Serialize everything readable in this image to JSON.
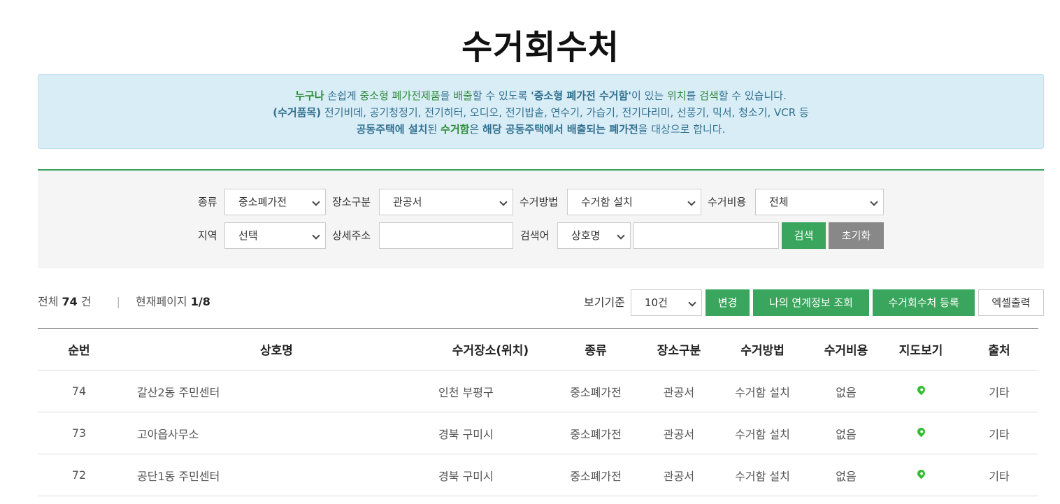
{
  "page": {
    "title": "수거회수처"
  },
  "notice": {
    "line1": {
      "a": "누구나",
      "b": " 손쉽게 ",
      "c": "중소형 폐가전제품",
      "d": "을 ",
      "e": "배출",
      "f": "할 수 있도록 ",
      "g": "'중소형 폐가전 수거함'",
      "h": "이 있는 ",
      "i": "위치",
      "j": "를 ",
      "k": "검색",
      "l": "할 수 있습니다."
    },
    "line2": {
      "a": "(수거품목)",
      "b": " 전기비데, 공기청정기, 전기히터, 오디오, 전기밥솥, 연수기, 가습기, 전기다리미, 선풍기, 믹서, 청소기, VCR 등"
    },
    "line3": {
      "a": "공동주택에 설치",
      "b": "된 ",
      "c": "수거함",
      "d": "은 ",
      "e": "해당 공동주택에서 배출되는 폐가전",
      "f": "을 대상으로 합니다."
    }
  },
  "search": {
    "type_label": "종류",
    "type_value": "중소폐가전",
    "place_label": "장소구분",
    "place_value": "관공서",
    "method_label": "수거방법",
    "method_value": "수거함 설치",
    "cost_label": "수거비용",
    "cost_value": "전체",
    "region_label": "지역",
    "region_value": "선택",
    "address_label": "상세주소",
    "address_value": "",
    "keyword_label": "검색어",
    "keyword_field": "상호명",
    "keyword_value": "",
    "search_button": "검색",
    "reset_button": "초기화"
  },
  "summary": {
    "total_prefix": "전체",
    "total_count": "74",
    "total_suffix": "건",
    "divider": "|",
    "page_prefix": "현재페이지",
    "page_value": "1/8"
  },
  "toolbar": {
    "view_label": "보기기준",
    "view_value": "10건",
    "change_button": "변경",
    "my_info_button": "나의 연계정보 조회",
    "register_button": "수거회수처 등록",
    "excel_button": "엑셀출력"
  },
  "table": {
    "headers": [
      "순번",
      "상호명",
      "수거장소(위치)",
      "종류",
      "장소구분",
      "수거방법",
      "수거비용",
      "지도보기",
      "출처"
    ],
    "rows": [
      {
        "no": "74",
        "name": "갈산2동 주민센터",
        "location": "인천 부평구",
        "type": "중소폐가전",
        "place": "관공서",
        "method": "수거함 설치",
        "cost": "없음",
        "source": "기타"
      },
      {
        "no": "73",
        "name": "고아읍사무소",
        "location": "경북 구미시",
        "type": "중소폐가전",
        "place": "관공서",
        "method": "수거함 설치",
        "cost": "없음",
        "source": "기타"
      },
      {
        "no": "72",
        "name": "공단1동 주민센터",
        "location": "경북 구미시",
        "type": "중소폐가전",
        "place": "관공서",
        "method": "수거함 설치",
        "cost": "없음",
        "source": "기타"
      }
    ]
  },
  "icons": {
    "map": "map-pin-icon",
    "dropdown": "chevron-down-icon"
  },
  "colors": {
    "accent": "#3aa65d",
    "notice_bg": "#d9edf7",
    "notice_text": "#31708f",
    "pin": "#2fbf2f"
  }
}
